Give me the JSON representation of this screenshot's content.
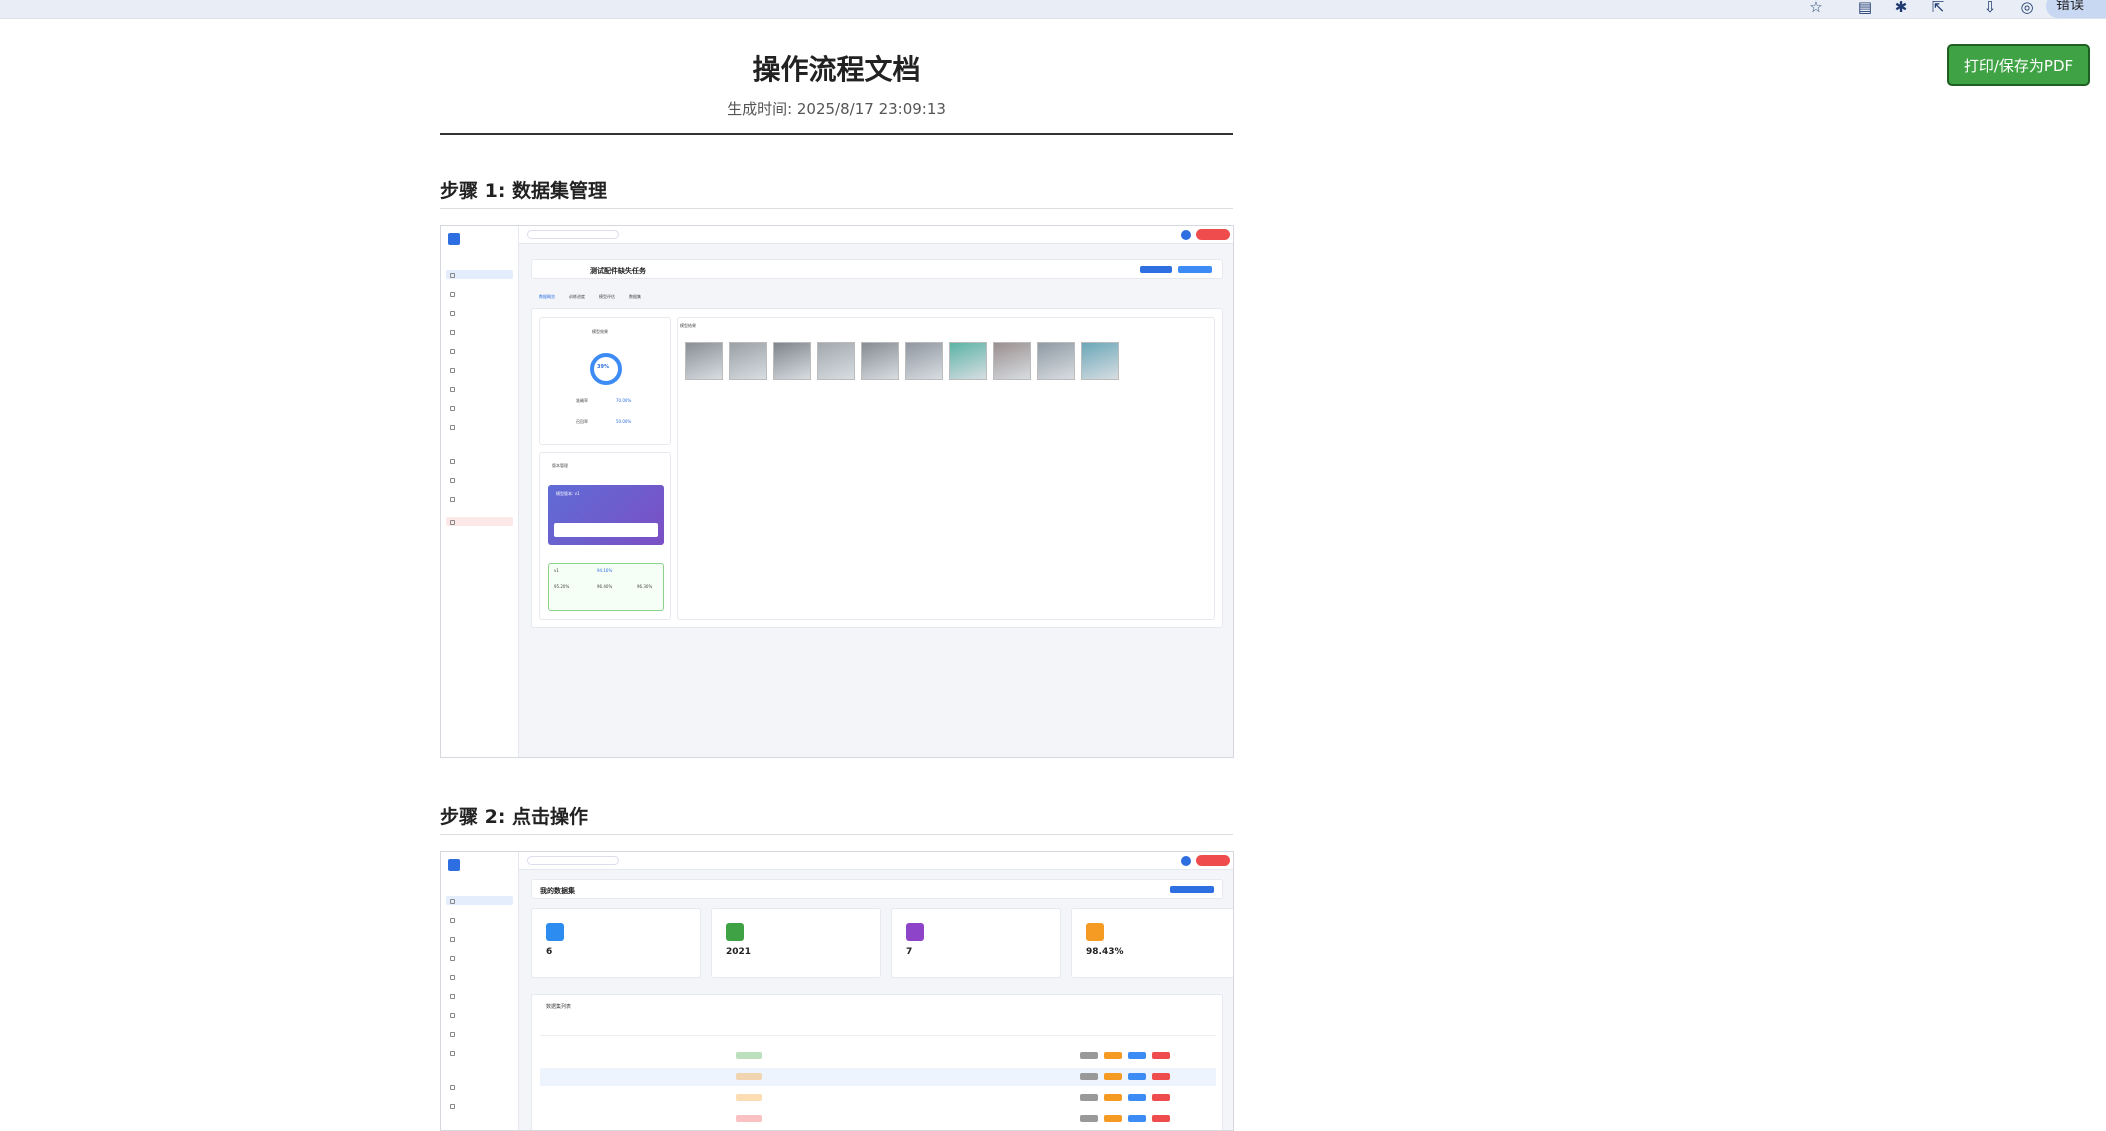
{
  "browser": {
    "icons": [
      "star-icon",
      "reading-list-icon",
      "extensions-icon",
      "share-icon",
      "download-icon",
      "profile-icon"
    ],
    "error_pill": "错误"
  },
  "header": {
    "title": "操作流程文档",
    "generated_time": "生成时间: 2025/8/17 23:09:13",
    "print_button": "打印/保存为PDF"
  },
  "steps": [
    {
      "heading": "步骤 1: 数据集管理",
      "screenshot": {
        "task_title": "测试配件缺失任务",
        "tabs": [
          "数据概览",
          "训练进度",
          "模型评估",
          "数据集"
        ],
        "card_left_title": "模型效果",
        "donut_value": "39%",
        "metric_rows": [
          {
            "label": "准确率",
            "value": "70.00%"
          },
          {
            "label": "召回率",
            "value": "50.00%"
          }
        ],
        "version_title": "版本管理",
        "version_banner": "模型版本: v1",
        "version_card": {
          "name": "v1",
          "score": "94.16%",
          "cols": [
            {
              "label": "精确率",
              "value": "95.20%"
            },
            {
              "label": "召回率",
              "value": "96.40%"
            },
            {
              "label": "mAP",
              "value": "96.30%"
            }
          ]
        },
        "right_title": "模型结果",
        "thumb_count": 10
      }
    },
    {
      "heading": "步骤 2: 点击操作",
      "screenshot": {
        "page_title": "我的数据集",
        "stats": [
          {
            "value": "6",
            "color": "#2d8cf0"
          },
          {
            "value": "2021",
            "color": "#3fa244"
          },
          {
            "value": "7",
            "color": "#8e44c8"
          },
          {
            "value": "98.43%",
            "color": "#f59a23"
          }
        ],
        "list_title": "数据集列表",
        "row_count": 4
      }
    }
  ]
}
